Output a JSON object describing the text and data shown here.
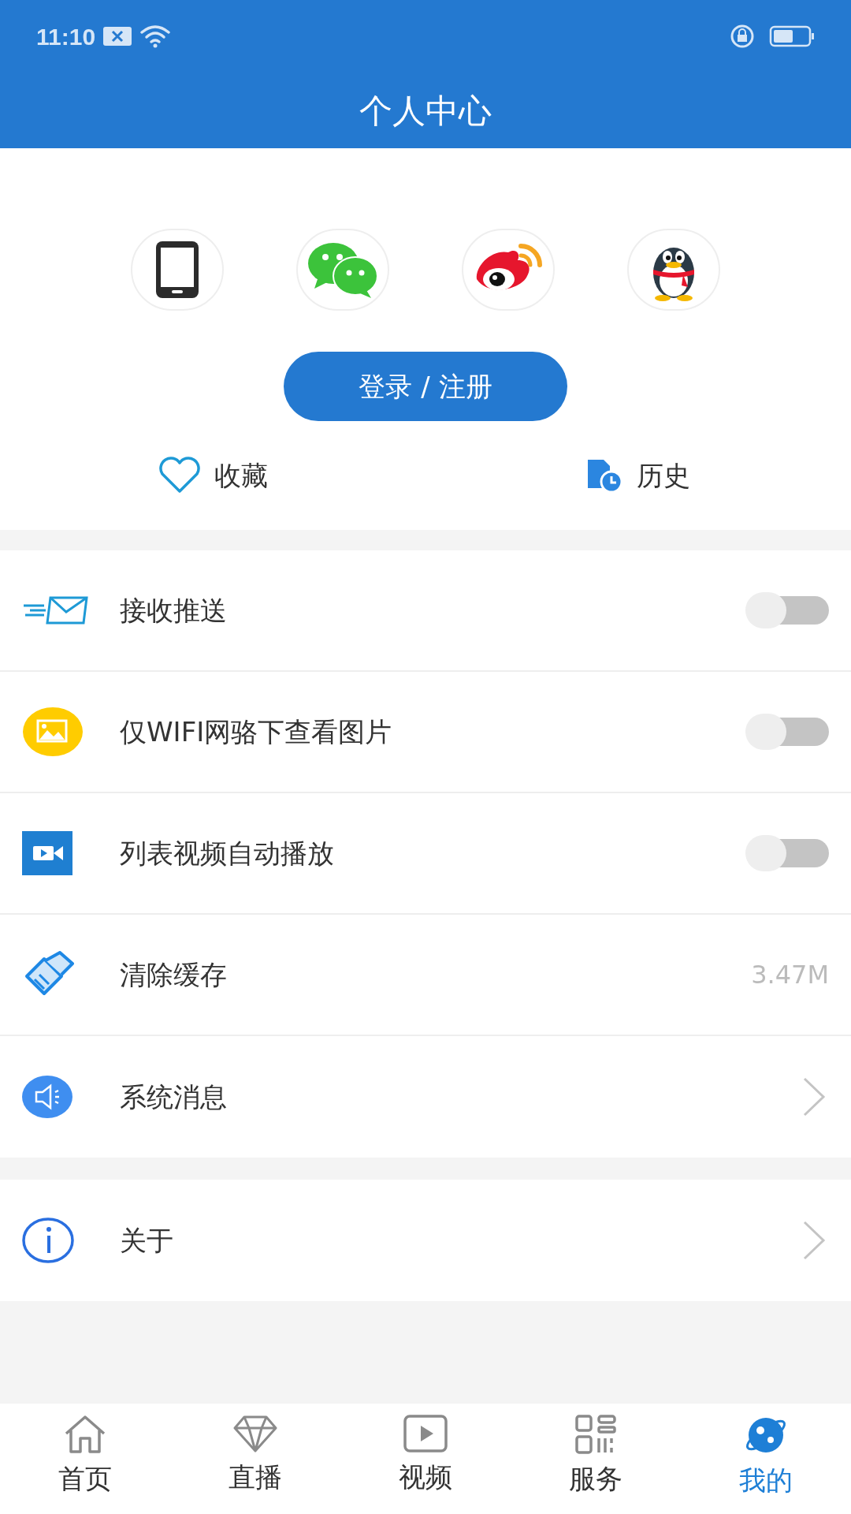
{
  "status_bar": {
    "time": "11:10"
  },
  "header": {
    "title": "个人中心"
  },
  "login": {
    "button": "登录 / 注册"
  },
  "shortcuts": [
    {
      "kind": "favorite",
      "label": "收藏"
    },
    {
      "kind": "history",
      "label": "历史"
    }
  ],
  "settings": [
    {
      "kind": "toggle",
      "label": "接收推送",
      "on": false
    },
    {
      "kind": "toggle",
      "label": "仅WIFI网骆下查看图片",
      "on": false
    },
    {
      "kind": "toggle",
      "label": "列表视频自动播放",
      "on": false
    },
    {
      "kind": "value",
      "label": "清除缓存",
      "value": "3.47M"
    },
    {
      "kind": "arrow",
      "label": "系统消息"
    }
  ],
  "about": [
    {
      "kind": "arrow",
      "label": "关于"
    }
  ],
  "tab_bar": [
    {
      "label": "首页",
      "selected": false
    },
    {
      "label": "直播",
      "selected": false
    },
    {
      "label": "视频",
      "selected": false
    },
    {
      "label": "服务",
      "selected": false
    },
    {
      "label": "我的",
      "selected": true
    }
  ]
}
